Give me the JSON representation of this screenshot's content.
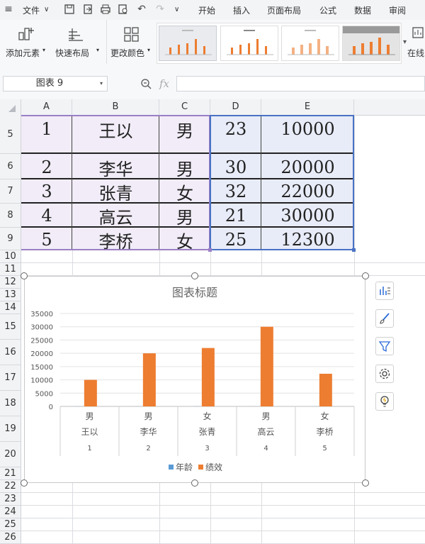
{
  "menubar": {
    "file_label": "文件",
    "tabs": [
      "开始",
      "插入",
      "页面布局",
      "公式",
      "数据",
      "审阅"
    ]
  },
  "ribbon": {
    "add_element": "添加元素",
    "quick_layout": "快速布局",
    "change_color": "更改颜色",
    "online_label": "在线"
  },
  "formula_bar": {
    "name_box": "图表 9",
    "fx": "fx",
    "formula": ""
  },
  "columns": [
    "A",
    "B",
    "C",
    "D",
    "E"
  ],
  "rows": [
    {
      "num": "5",
      "a": "1",
      "b": "王以",
      "c": "男",
      "d": "23",
      "e": "10000"
    },
    {
      "num": "6",
      "a": "2",
      "b": "李华",
      "c": "男",
      "d": "30",
      "e": "20000"
    },
    {
      "num": "7",
      "a": "3",
      "b": "张青",
      "c": "女",
      "d": "32",
      "e": "22000"
    },
    {
      "num": "8",
      "a": "4",
      "b": "高云",
      "c": "男",
      "d": "21",
      "e": "30000"
    },
    {
      "num": "9",
      "a": "5",
      "b": "李桥",
      "c": "女",
      "d": "25",
      "e": "12300"
    }
  ],
  "empty_rows": [
    "10",
    "11",
    "12",
    "13",
    "14",
    "15",
    "16",
    "17",
    "18",
    "19",
    "20",
    "21",
    "22",
    "23",
    "24",
    "25",
    "26"
  ],
  "chart_data": {
    "type": "bar",
    "title": "图表标题",
    "categories": [
      {
        "l1": "男",
        "l2": "王以",
        "l3": "1"
      },
      {
        "l1": "男",
        "l2": "李华",
        "l3": "2"
      },
      {
        "l1": "女",
        "l2": "张青",
        "l3": "3"
      },
      {
        "l1": "男",
        "l2": "高云",
        "l3": "4"
      },
      {
        "l1": "女",
        "l2": "李桥",
        "l3": "5"
      }
    ],
    "series": [
      {
        "name": "年龄",
        "color": "#5b9bd5",
        "values": [
          23,
          30,
          32,
          21,
          25
        ]
      },
      {
        "name": "绩效",
        "color": "#ed7d31",
        "values": [
          10000,
          20000,
          22000,
          30000,
          12300
        ]
      }
    ],
    "ylim": [
      0,
      35000
    ],
    "yticks": [
      "35000",
      "30000",
      "25000",
      "20000",
      "15000",
      "10000",
      "5000",
      "0"
    ],
    "grid": true,
    "legend": "bottom"
  },
  "colors": {
    "selection_purple": "#9b7fc6",
    "selection_blue": "#4a72c4",
    "fill_purple": "#f1ecf7",
    "fill_blue": "#e8ecf8",
    "bar_orange": "#ed7d31"
  }
}
